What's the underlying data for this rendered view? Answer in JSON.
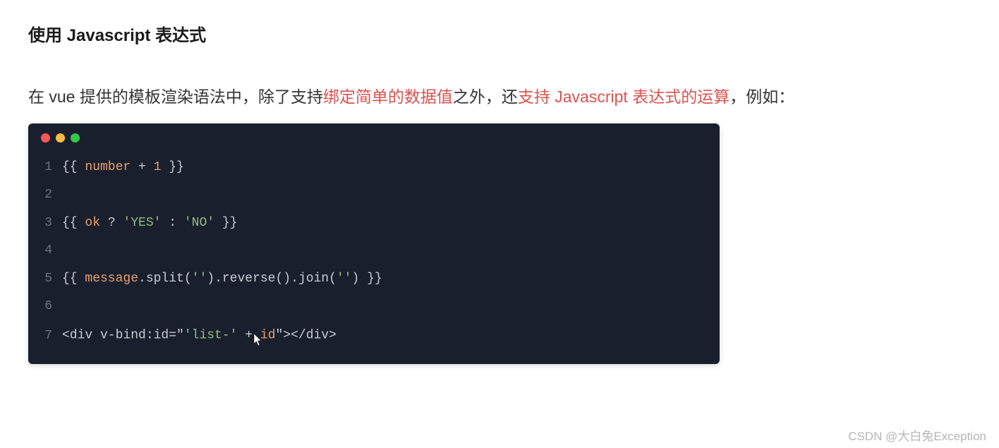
{
  "heading": "使用 Javascript 表达式",
  "paragraph": {
    "p1": "在 vue 提供的模板渲染语法中，除了支持",
    "h1": "绑定简单的数据值",
    "p2": "之外，还",
    "h2": "支持 Javascript 表达式的运算",
    "p3": "，例如：",
    "full": "在 vue 提供的模板渲染语法中，除了支持绑定简单的数据值之外，还支持 Javascript 表达式的运算，例如："
  },
  "code": {
    "lines": [
      {
        "num": "1",
        "tokens": [
          {
            "t": "{{ ",
            "c": "plain"
          },
          {
            "t": "number",
            "c": "orange"
          },
          {
            "t": " + ",
            "c": "plain"
          },
          {
            "t": "1",
            "c": "orange"
          },
          {
            "t": " }}",
            "c": "plain"
          }
        ],
        "raw": "{{ number + 1 }}"
      },
      {
        "num": "2",
        "tokens": [],
        "raw": ""
      },
      {
        "num": "3",
        "tokens": [
          {
            "t": "{{ ",
            "c": "plain"
          },
          {
            "t": "ok",
            "c": "orange"
          },
          {
            "t": " ? ",
            "c": "plain"
          },
          {
            "t": "'YES'",
            "c": "green"
          },
          {
            "t": " : ",
            "c": "plain"
          },
          {
            "t": "'NO'",
            "c": "green"
          },
          {
            "t": " }}",
            "c": "plain"
          }
        ],
        "raw": "{{ ok ? 'YES' : 'NO' }}"
      },
      {
        "num": "4",
        "tokens": [],
        "raw": ""
      },
      {
        "num": "5",
        "tokens": [
          {
            "t": "{{ ",
            "c": "plain"
          },
          {
            "t": "message",
            "c": "orange"
          },
          {
            "t": ".split(",
            "c": "plain"
          },
          {
            "t": "''",
            "c": "green"
          },
          {
            "t": ").reverse().join(",
            "c": "plain"
          },
          {
            "t": "''",
            "c": "green"
          },
          {
            "t": ") }}",
            "c": "plain"
          }
        ],
        "raw": "{{ message.split('').reverse().join('') }}"
      },
      {
        "num": "6",
        "tokens": [],
        "raw": ""
      },
      {
        "num": "7",
        "tokens": [
          {
            "t": "<div v-bind:id=",
            "c": "plain"
          },
          {
            "t": "\"",
            "c": "plain"
          },
          {
            "t": "'list-'",
            "c": "green"
          },
          {
            "t": " + ",
            "c": "plain"
          },
          {
            "t": "id",
            "c": "orange"
          },
          {
            "t": "\"",
            "c": "plain"
          },
          {
            "t": "></div>",
            "c": "plain"
          }
        ],
        "raw": "<div v-bind:id=\"'list-' + id\"></div>"
      }
    ]
  },
  "watermark": "CSDN @大白兔Exception"
}
